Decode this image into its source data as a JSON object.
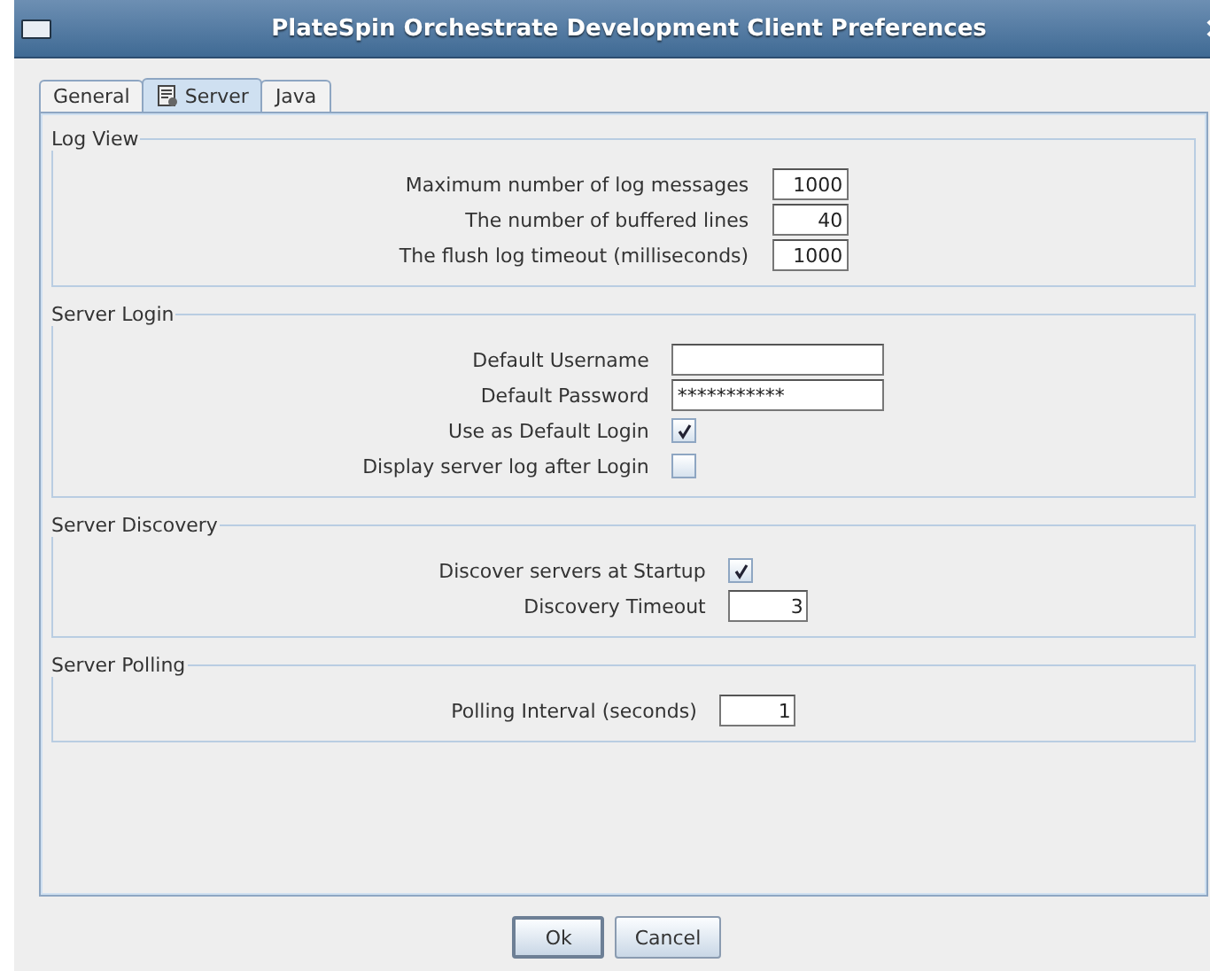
{
  "window": {
    "title": "PlateSpin Orchestrate Development Client Preferences"
  },
  "tabs": [
    {
      "label": "General",
      "selected": false
    },
    {
      "label": "Server",
      "selected": true
    },
    {
      "label": "Java",
      "selected": false
    }
  ],
  "groups": [
    {
      "title": "Log View",
      "rows": [
        {
          "kind": "number",
          "label": "Maximum number of log messages",
          "value": "1000"
        },
        {
          "kind": "number",
          "label": "The number of buffered lines",
          "value": "40"
        },
        {
          "kind": "number",
          "label": "The flush log timeout (milliseconds)",
          "value": "1000"
        }
      ]
    },
    {
      "title": "Server Login",
      "rows": [
        {
          "kind": "text",
          "label": "Default Username",
          "value": ""
        },
        {
          "kind": "password",
          "label": "Default Password",
          "value": "***********"
        },
        {
          "kind": "checkbox",
          "label": "Use as Default Login",
          "checked": true
        },
        {
          "kind": "checkbox",
          "label": "Display server log after Login",
          "checked": false
        }
      ]
    },
    {
      "title": "Server Discovery",
      "rows": [
        {
          "kind": "checkbox",
          "label": "Discover servers at Startup",
          "checked": true
        },
        {
          "kind": "number",
          "label": "Discovery Timeout",
          "value": "3"
        }
      ]
    },
    {
      "title": "Server Polling",
      "rows": [
        {
          "kind": "number",
          "label": "Polling Interval (seconds)",
          "value": "1"
        }
      ]
    }
  ],
  "buttons": [
    {
      "label": "Ok",
      "default": true
    },
    {
      "label": "Cancel",
      "default": false
    }
  ]
}
